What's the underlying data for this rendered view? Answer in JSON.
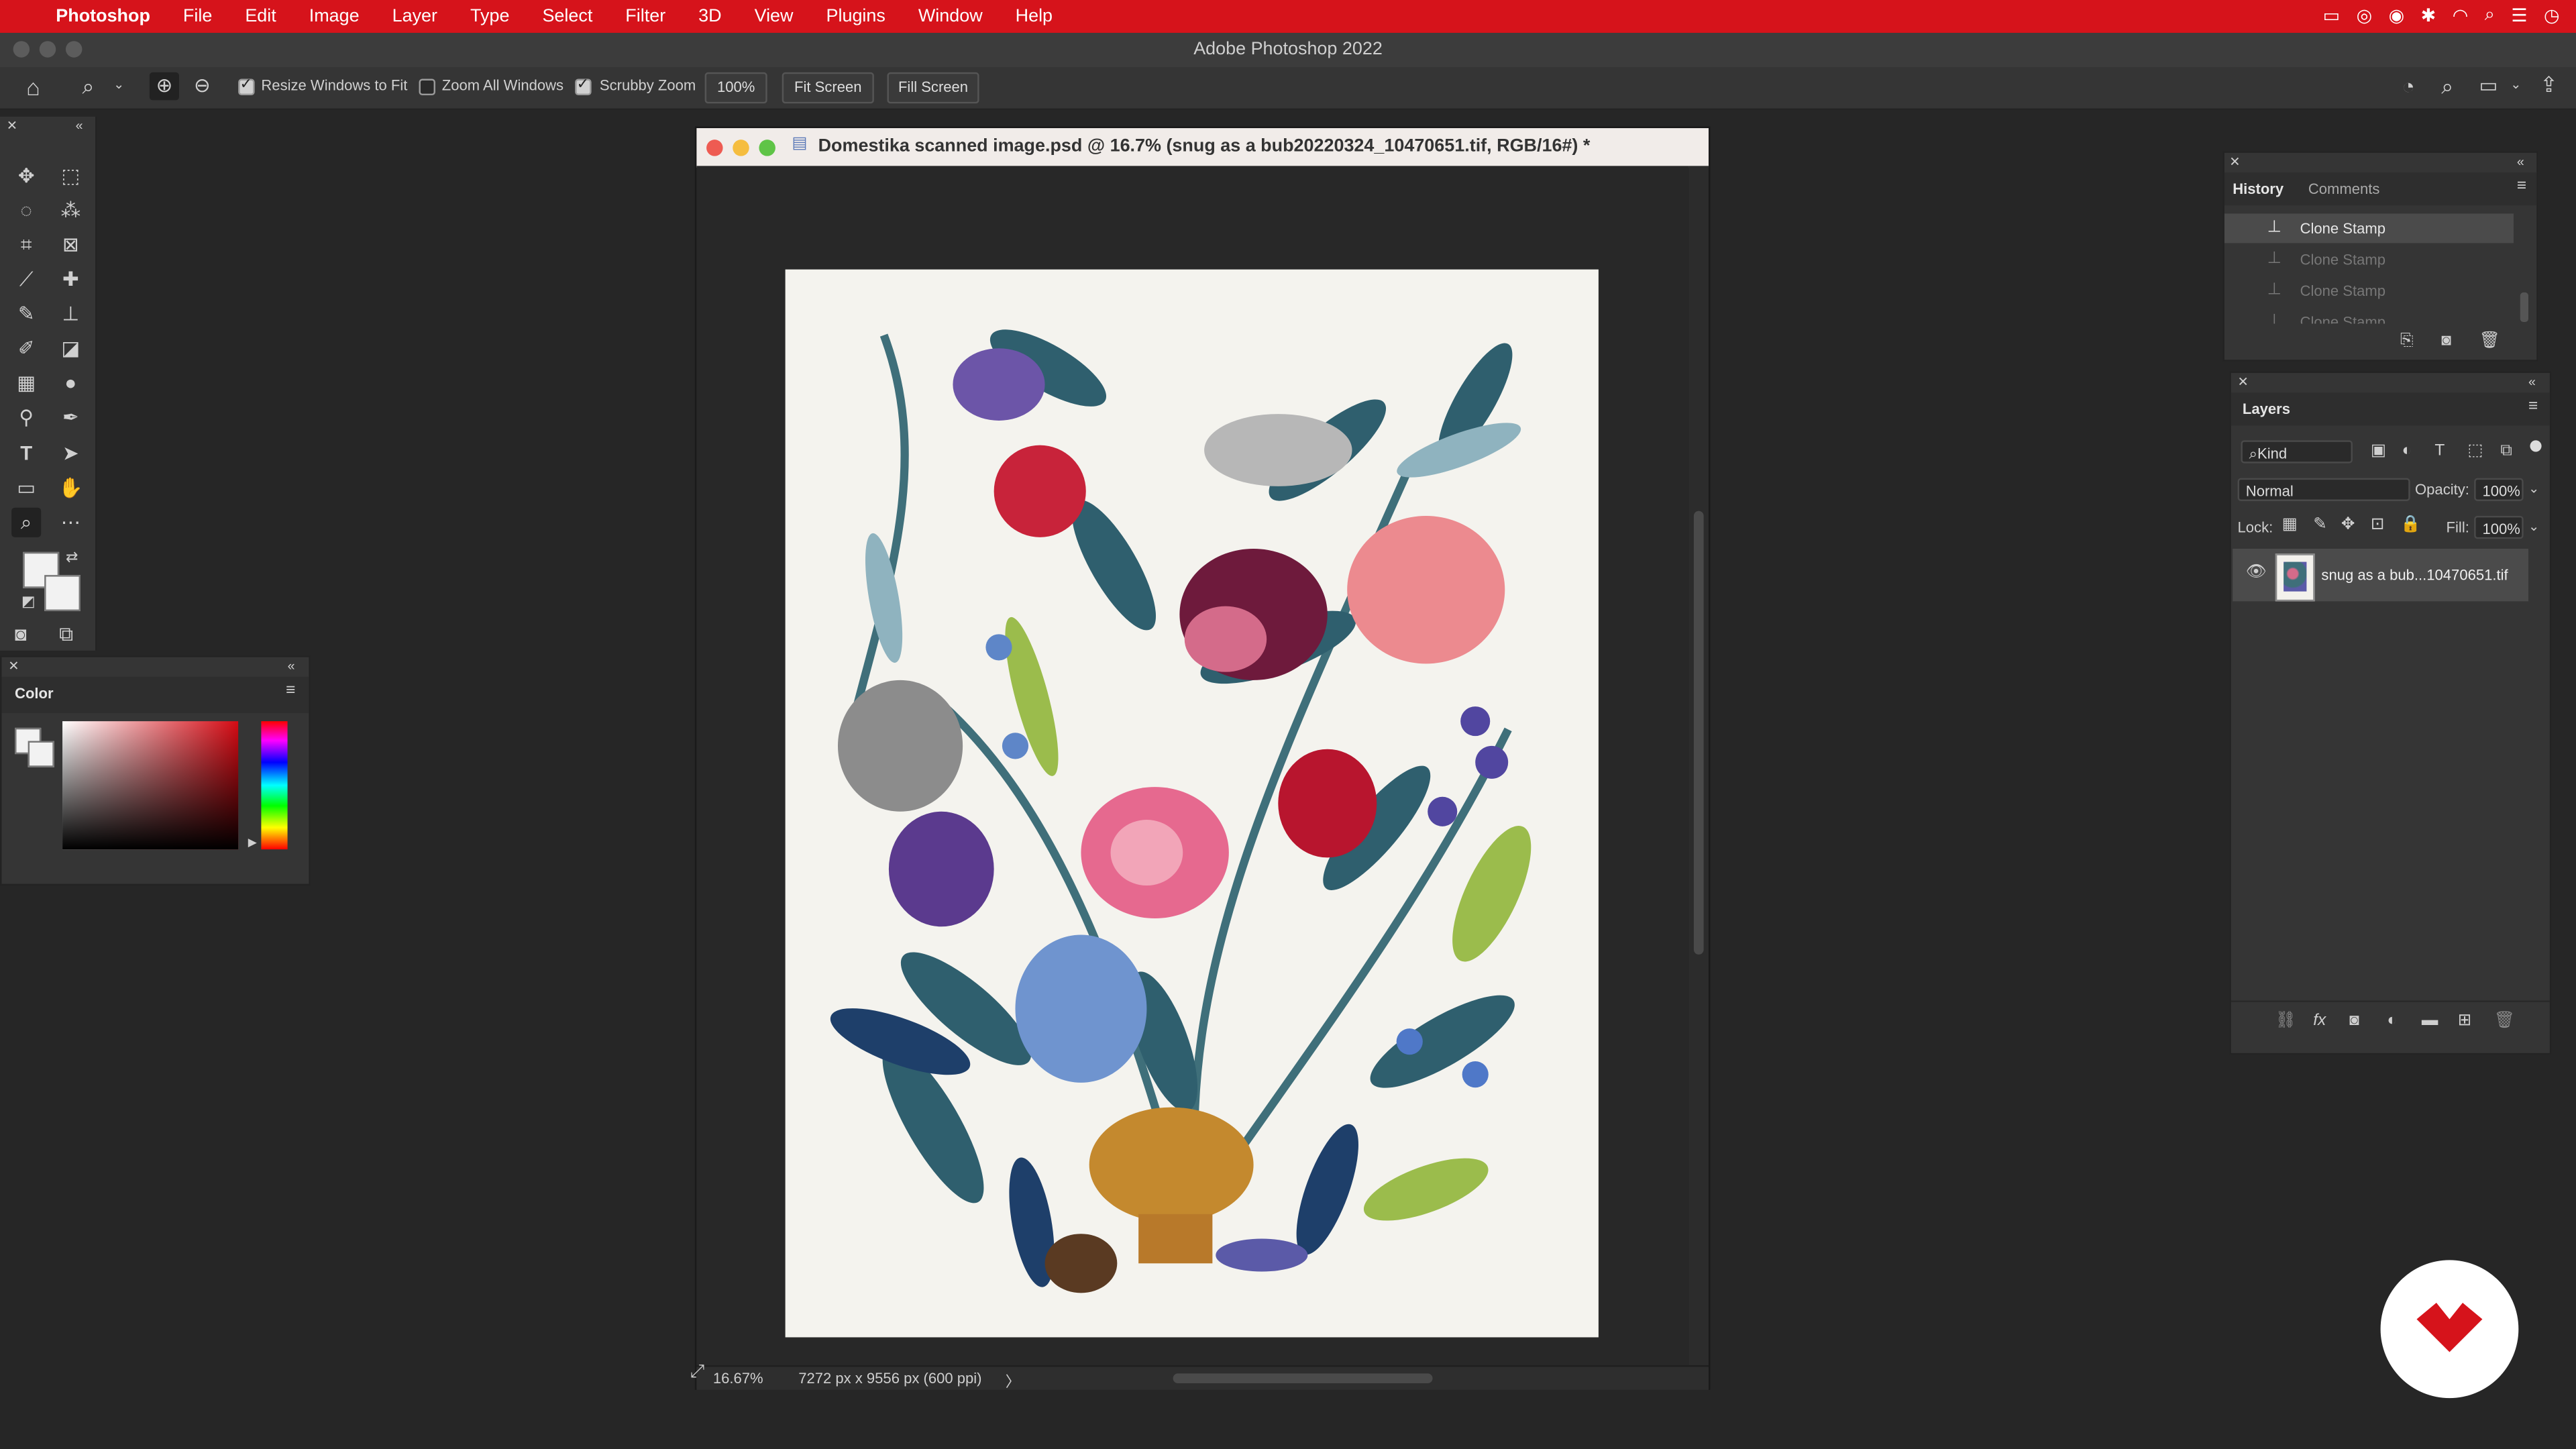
{
  "menubar": {
    "apple": "",
    "app_name": "Photoshop",
    "items": [
      "File",
      "Edit",
      "Image",
      "Layer",
      "Type",
      "Select",
      "Filter",
      "3D",
      "View",
      "Plugins",
      "Window",
      "Help"
    ]
  },
  "window_title": "Adobe Photoshop 2022",
  "options_bar": {
    "resize_windows_label": "Resize Windows to Fit",
    "resize_windows_checked": true,
    "zoom_all_label": "Zoom All Windows",
    "zoom_all_checked": false,
    "scrubby_label": "Scrubby Zoom",
    "scrubby_checked": true,
    "zoom_value": "100%",
    "fit_screen": "Fit Screen",
    "fill_screen": "Fill Screen"
  },
  "color_panel": {
    "tab": "Color"
  },
  "document": {
    "title": "Domestika scanned image.psd @ 16.7% (snug as a bub20220324_10470651.tif, RGB/16#) *",
    "zoom": "16.67%",
    "dimensions": "7272 px x 9556 px (600 ppi)",
    "status_arrow": "〉"
  },
  "history_panel": {
    "tabs": [
      "History",
      "Comments"
    ],
    "items": [
      {
        "label": "Clone Stamp",
        "selected": true
      },
      {
        "label": "Clone Stamp",
        "selected": false
      },
      {
        "label": "Clone Stamp",
        "selected": false
      },
      {
        "label": "Clone Stamp",
        "selected": false
      }
    ]
  },
  "layers_panel": {
    "tab": "Layers",
    "filter": "Kind",
    "blend_mode": "Normal",
    "opacity_label": "Opacity:",
    "opacity_value": "100%",
    "lock_label": "Lock:",
    "fill_label": "Fill:",
    "fill_value": "100%",
    "layers": [
      {
        "name": "snug as a bub...10470651.tif",
        "visible": true
      }
    ]
  },
  "colors": {
    "menubar": "#d6131b",
    "app_bg": "#262626",
    "panel": "#353535",
    "doc_title_bg": "#f1ece9",
    "logo_red": "#d6131b"
  }
}
